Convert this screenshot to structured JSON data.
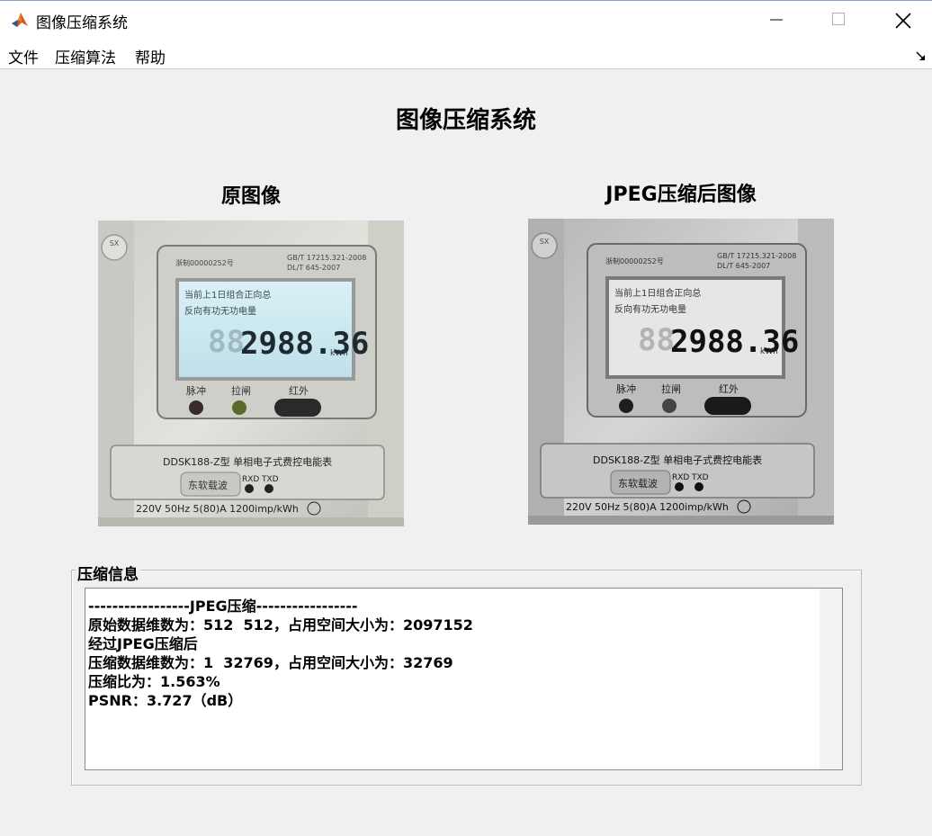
{
  "window": {
    "title": "图像压缩系统"
  },
  "menu": {
    "items": [
      "文件",
      "压缩算法",
      "帮助"
    ]
  },
  "main": {
    "title": "图像压缩系统",
    "original_label": "原图像",
    "compressed_label": "JPEG压缩后图像"
  },
  "meter": {
    "sx_logo": "SX",
    "standard": "GB/T 17215.321-2008",
    "standard2": "DL/T 645-2007",
    "cert": "浙制00000252号",
    "lcd_line1": "当前上1日组合正向总",
    "lcd_line2": "反向有功无功电量",
    "reading": "2988.36",
    "unit": "kWh",
    "label_pulse": "脉冲",
    "label_switch": "拉闸",
    "label_ir": "红外",
    "model": "DDSK188-Z型 单相电子式费控电能表",
    "carrier": "东软载波",
    "rxd": "RXD",
    "txd": "TXD",
    "spec": "220V  50Hz  5(80)A  1200imp/kWh"
  },
  "info": {
    "group_label": "压缩信息",
    "lines": [
      "-----------------JPEG压缩-----------------",
      "原始数据维数为：512  512，占用空间大小为：2097152",
      "经过JPEG压缩后",
      "压缩数据维数为：1  32769，占用空间大小为：32769",
      "压缩比为：1.563%",
      "PSNR：3.727（dB）"
    ]
  },
  "colors": {
    "lcd_color": "#cfe8ef",
    "lcd_gray": "#e6e6e6",
    "background": "#f0f0f0"
  }
}
